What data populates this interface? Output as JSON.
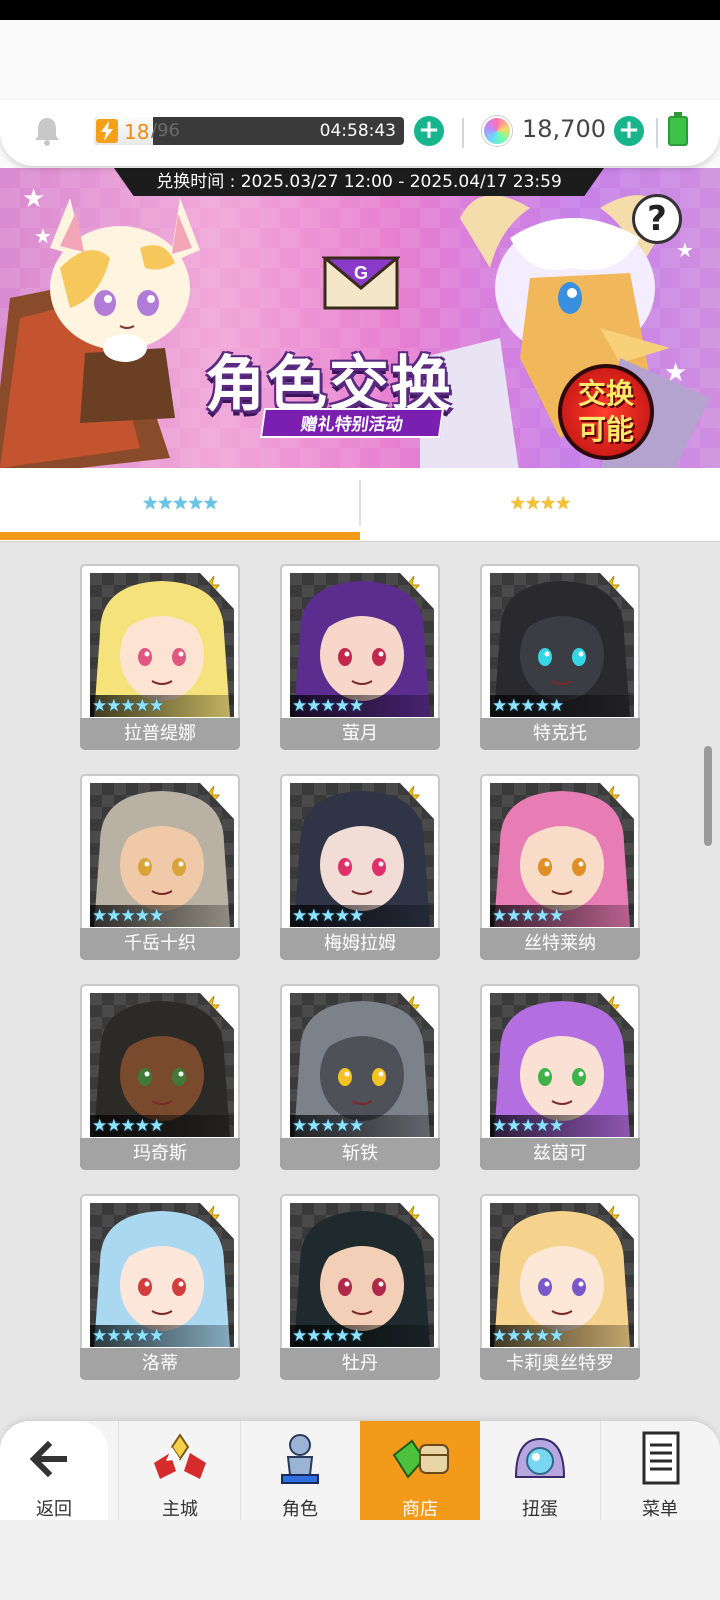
{
  "resources": {
    "stamina_current": "18",
    "stamina_max": "/96",
    "stamina_timer": "04:58:43",
    "stamina_fill": 0.19,
    "gems": "18,700"
  },
  "banner": {
    "exchange_period": "兑换时间 : 2025.03/27 12:00 - 2025.04/17 23:59",
    "title": "角色交换",
    "subtitle": "赠礼特别活动",
    "badge": "交换可能",
    "help": "?",
    "letter_glyph": "G"
  },
  "tabs": [
    {
      "label": "★★★★★",
      "rarity": 5,
      "active": true
    },
    {
      "label": "★★★★",
      "rarity": 4,
      "active": false
    }
  ],
  "characters": [
    {
      "name": "拉普缇娜",
      "stars": "★★★★★",
      "hair": "#f6e27a",
      "skin": "#fde3d2",
      "eye": "#e0577f"
    },
    {
      "name": "萤月",
      "stars": "★★★★★",
      "hair": "#5b2d8e",
      "skin": "#f7d7c9",
      "eye": "#c2284c"
    },
    {
      "name": "特克托",
      "stars": "★★★★★",
      "hair": "#2a2a2e",
      "skin": "#3c3c44",
      "eye": "#35d7e6"
    },
    {
      "name": "千岳十织",
      "stars": "★★★★★",
      "hair": "#b9b1a4",
      "skin": "#f0c9a8",
      "eye": "#d9a33a"
    },
    {
      "name": "梅姆拉姆",
      "stars": "★★★★★",
      "hair": "#2f3446",
      "skin": "#f2dcd6",
      "eye": "#e0306a"
    },
    {
      "name": "丝特莱纳",
      "stars": "★★★★★",
      "hair": "#e87cb4",
      "skin": "#f8dcc8",
      "eye": "#e08e26"
    },
    {
      "name": "玛奇斯",
      "stars": "★★★★★",
      "hair": "#2c2a26",
      "skin": "#7a4a2e",
      "eye": "#3f7a3a"
    },
    {
      "name": "斩铁",
      "stars": "★★★★★",
      "hair": "#7d8189",
      "skin": "#4e5258",
      "eye": "#f2c323"
    },
    {
      "name": "兹茵可",
      "stars": "★★★★★",
      "hair": "#b36ee0",
      "skin": "#fbe1d3",
      "eye": "#3fb34a"
    },
    {
      "name": "洛蒂",
      "stars": "★★★★★",
      "hair": "#a9d8f0",
      "skin": "#fde6da",
      "eye": "#d23e3e"
    },
    {
      "name": "牡丹",
      "stars": "★★★★★",
      "hair": "#1f2a2e",
      "skin": "#f4cfb8",
      "eye": "#b0284a"
    },
    {
      "name": "卡莉奥丝特罗",
      "stars": "★★★★★",
      "hair": "#f6d38c",
      "skin": "#fde7d6",
      "eye": "#7a58c8"
    }
  ],
  "nav": {
    "back": "返回",
    "home": "主城",
    "characters": "角色",
    "shop": "商店",
    "gacha": "扭蛋",
    "menu": "菜单"
  },
  "colors": {
    "accent": "#f39a1b",
    "plus_button": "#16b58b",
    "name_bar": "#a3a3a3"
  },
  "icons": [
    "bell-icon",
    "lightning-icon",
    "plus-icon",
    "gem-icon",
    "battery-icon",
    "help-icon",
    "back-arrow-icon",
    "castle-icon",
    "character-icon",
    "shop-icon",
    "gacha-icon",
    "menu-icon"
  ]
}
